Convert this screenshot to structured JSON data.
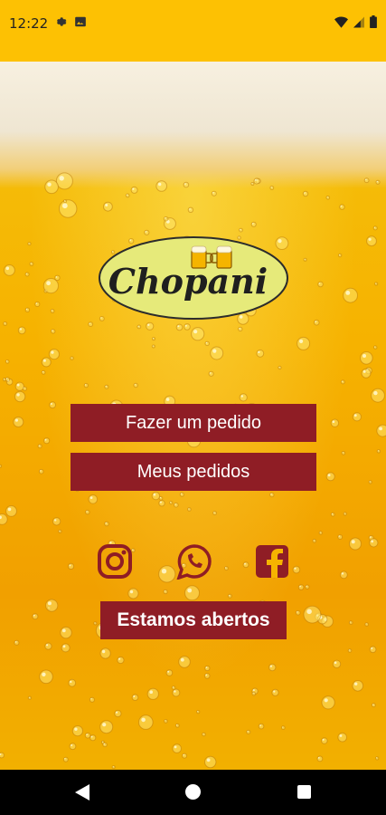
{
  "status_bar": {
    "time": "12:22",
    "left_icons": [
      "settings-icon",
      "image-icon"
    ],
    "right_icons": [
      "wifi-icon",
      "signal-icon",
      "battery-icon"
    ],
    "background": "#fdc103"
  },
  "logo": {
    "text": "Chopani",
    "icon": "beer-mugs-icon"
  },
  "actions": {
    "order_label": "Fazer um pedido",
    "my_orders_label": "Meus pedidos"
  },
  "social": [
    "instagram-icon",
    "whatsapp-icon",
    "facebook-icon"
  ],
  "store_status": "Estamos abertos",
  "colors": {
    "brand_red": "#8f1d25",
    "logo_fill": "#e6ea7a"
  },
  "nav_bar": [
    "back-icon",
    "home-icon",
    "recents-icon"
  ]
}
